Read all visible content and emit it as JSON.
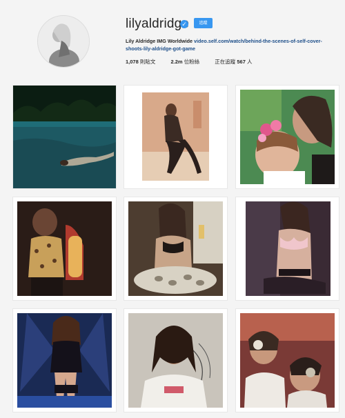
{
  "profile": {
    "username": "lilyaldridge",
    "verified_icon": "check",
    "follow_label": "追蹤",
    "name": "Lily Aldridge IMG Worldwide",
    "link": "video.self.com/watch/behind-the-scenes-of-self-cover-shoots-lily-aldridge-got-game",
    "stats": {
      "posts_value": "1,078",
      "posts_label": "則貼文",
      "followers_value": "2.2m",
      "followers_label": "位粉絲",
      "following_label": "正在追蹤",
      "following_value": "567",
      "following_unit": "人"
    }
  },
  "posts": [
    {
      "id": "pool-swim"
    },
    {
      "id": "legs-pose"
    },
    {
      "id": "selfie-flowers"
    },
    {
      "id": "leopard-top"
    },
    {
      "id": "oyster-dinner"
    },
    {
      "id": "lingerie-pink"
    },
    {
      "id": "runway-wings"
    },
    {
      "id": "girl-portrait"
    },
    {
      "id": "glitter-faces"
    }
  ]
}
